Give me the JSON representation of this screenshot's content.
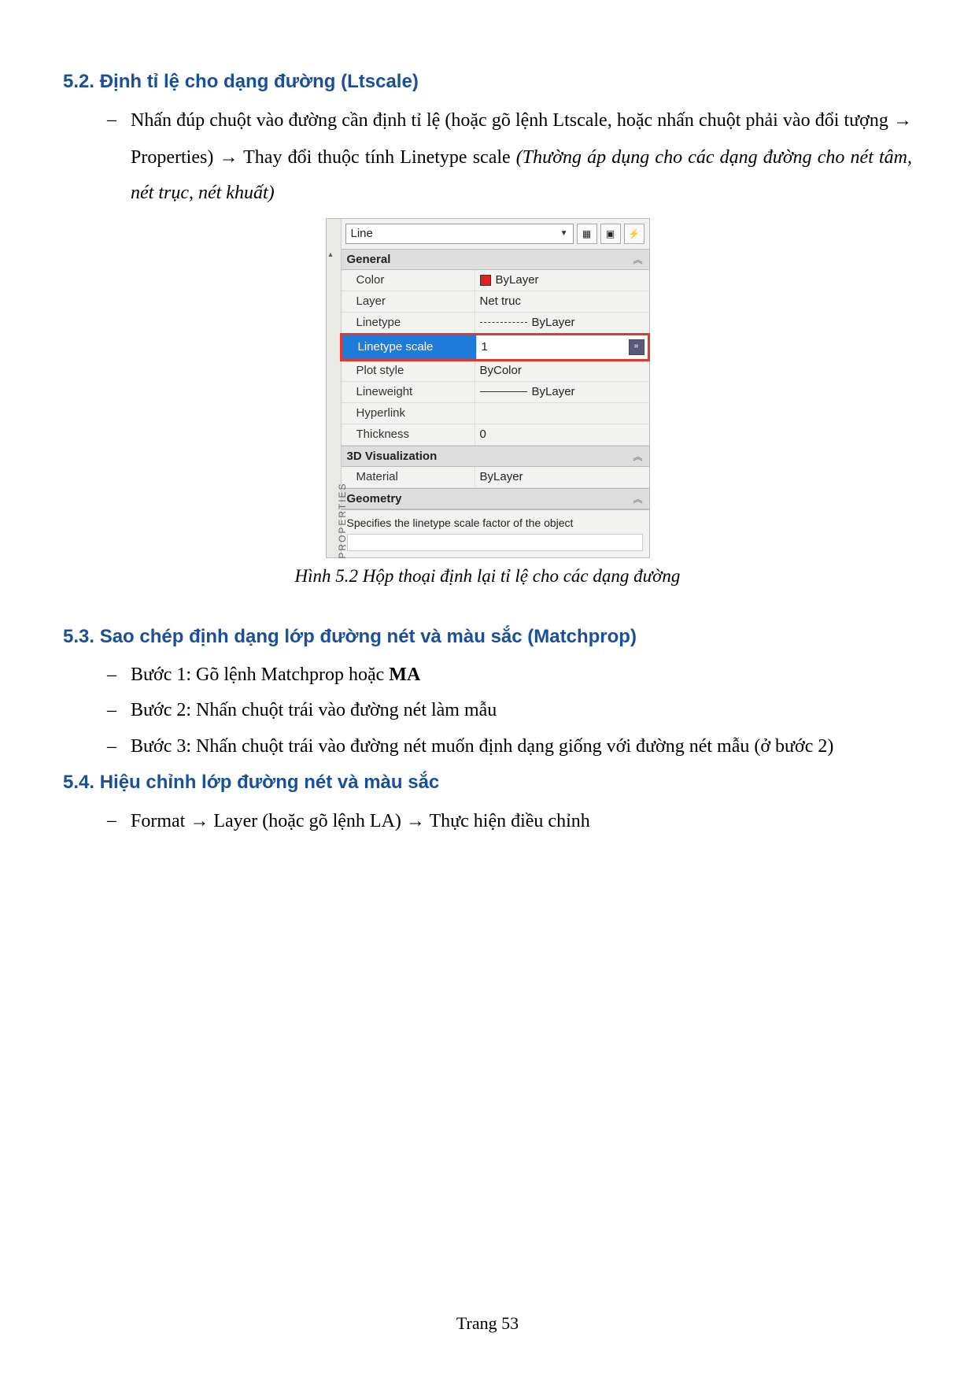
{
  "sections": {
    "s52_title": "5.2.  Định tỉ lệ cho dạng đường (Ltscale)",
    "s52_item1_a": "Nhấn đúp chuột vào đường cần định tỉ lệ (hoặc gõ lệnh Ltscale, hoặc nhấn chuột phải vào đổi tượng ",
    "s52_item1_b": " Properties) ",
    "s52_item1_c": " Thay đổi thuộc tính Linetype scale ",
    "s52_note": "(Thường áp dụng cho các dạng đường cho nét tâm, nét trục, nét khuất)",
    "s53_title": "5.3.  Sao chép định dạng lớp đường nét và màu sắc (Matchprop)",
    "s53_step1_a": "Bước 1: Gõ lệnh Matchprop hoặc ",
    "s53_step1_b": "MA",
    "s53_step2": "Bước 2: Nhấn chuột trái vào đường nét làm mẫu",
    "s53_step3": "Bước 3: Nhấn chuột trái vào đường nét muốn định dạng giống với đường nét mẫu (ở bước 2)",
    "s54_title": "5.4.  Hiệu chỉnh lớp đường nét và màu sắc",
    "s54_item1_a": "Format ",
    "s54_item1_b": " Layer (hoặc gõ lệnh LA) ",
    "s54_item1_c": " Thực hiện điều chỉnh"
  },
  "figure_caption": "Hình 5.2 Hộp thoại định lại tỉ lệ cho các dạng đường",
  "page_number": "Trang 53",
  "arrow": "→",
  "panel": {
    "side_label": "PROPERTIES",
    "selector": "Line",
    "groups": {
      "general": "General",
      "viz3d": "3D Visualization",
      "geometry": "Geometry"
    },
    "props": {
      "color_label": "Color",
      "color_value": "ByLayer",
      "layer_label": "Layer",
      "layer_value": "Net truc",
      "linetype_label": "Linetype",
      "linetype_value": "ByLayer",
      "ltscale_label": "Linetype scale",
      "ltscale_value": "1",
      "plotstyle_label": "Plot style",
      "plotstyle_value": "ByColor",
      "lineweight_label": "Lineweight",
      "lineweight_value": "ByLayer",
      "hyperlink_label": "Hyperlink",
      "hyperlink_value": "",
      "thickness_label": "Thickness",
      "thickness_value": "0",
      "material_label": "Material",
      "material_value": "ByLayer"
    },
    "status": "Specifies the linetype scale factor of the object"
  }
}
